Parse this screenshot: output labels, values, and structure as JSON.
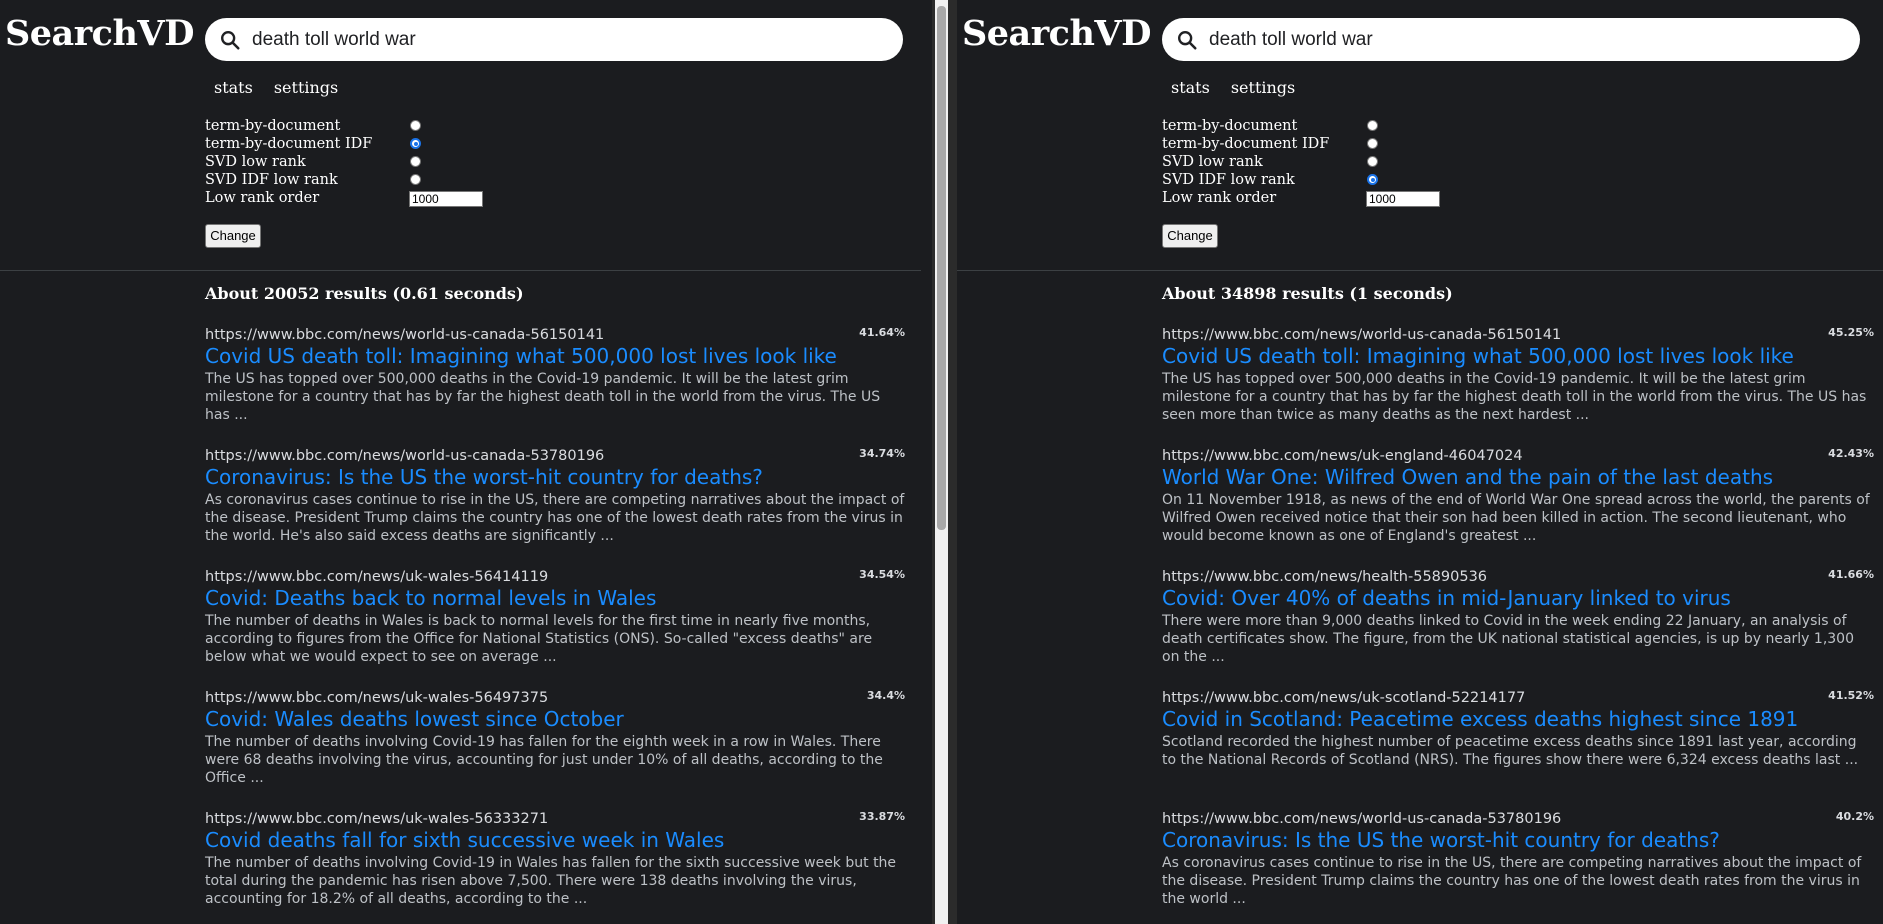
{
  "panes": [
    {
      "logo": "SearchVD",
      "query": "death toll world war",
      "nav": [
        "stats",
        "settings"
      ],
      "options": [
        {
          "label": "term-by-document",
          "checked": false
        },
        {
          "label": "term-by-document IDF",
          "checked": true
        },
        {
          "label": "SVD low rank",
          "checked": false
        },
        {
          "label": "SVD IDF low rank",
          "checked": false
        }
      ],
      "low_rank_label": "Low rank order",
      "low_rank_value": "1000",
      "change_label": "Change",
      "results_count": "About 20052 results (0.61 seconds)",
      "results": [
        {
          "url": "https://www.bbc.com/news/world-us-canada-56150141",
          "score": "41.64%",
          "title": "Covid US death toll: Imagining what 500,000 lost lives look like",
          "snippet": "The US has topped over 500,000 deaths in the Covid-19 pandemic. It will be the latest grim milestone for a country that has by far the highest death toll in the world from the virus. The US has ..."
        },
        {
          "url": "https://www.bbc.com/news/world-us-canada-53780196",
          "score": "34.74%",
          "title": "Coronavirus: Is the US the worst-hit country for deaths?",
          "snippet": "As coronavirus cases continue to rise in the US, there are competing narratives about the impact of the disease. President Trump claims the country has one of the lowest death rates from the virus in the world. He's also said excess deaths are significantly ..."
        },
        {
          "url": "https://www.bbc.com/news/uk-wales-56414119",
          "score": "34.54%",
          "title": "Covid: Deaths back to normal levels in Wales",
          "snippet": "The number of deaths in Wales is back to normal levels for the first time in nearly five months, according to figures from the Office for National Statistics (ONS). So-called \"excess deaths\" are below what we would expect to see on average ..."
        },
        {
          "url": "https://www.bbc.com/news/uk-wales-56497375",
          "score": "34.4%",
          "title": "Covid: Wales deaths lowest since October",
          "snippet": "The number of deaths involving Covid-19 has fallen for the eighth week in a row in Wales. There were 68 deaths involving the virus, accounting for just under 10% of all deaths, according to the Office ..."
        },
        {
          "url": "https://www.bbc.com/news/uk-wales-56333271",
          "score": "33.87%",
          "title": "Covid deaths fall for sixth successive week in Wales",
          "snippet": "The number of deaths involving Covid-19 in Wales has fallen for the sixth successive week but the total during the pandemic has risen above 7,500. There were 138 deaths involving the virus, accounting for 18.2% of all deaths, according to the ..."
        }
      ]
    },
    {
      "logo": "SearchVD",
      "query": "death toll world war",
      "nav": [
        "stats",
        "settings"
      ],
      "options": [
        {
          "label": "term-by-document",
          "checked": false
        },
        {
          "label": "term-by-document IDF",
          "checked": false
        },
        {
          "label": "SVD low rank",
          "checked": false
        },
        {
          "label": "SVD IDF low rank",
          "checked": true
        }
      ],
      "low_rank_label": "Low rank order",
      "low_rank_value": "1000",
      "change_label": "Change",
      "results_count": "About 34898 results (1 seconds)",
      "results": [
        {
          "url": "https://www.bbc.com/news/world-us-canada-56150141",
          "score": "45.25%",
          "title": "Covid US death toll: Imagining what 500,000 lost lives look like",
          "snippet": "The US has topped over 500,000 deaths in the Covid-19 pandemic. It will be the latest grim milestone for a country that has by far the highest death toll in the world from the virus. The US has seen more than twice as many deaths as the next hardest ..."
        },
        {
          "url": "https://www.bbc.com/news/uk-england-46047024",
          "score": "42.43%",
          "title": "World War One: Wilfred Owen and the pain of the last deaths",
          "snippet": "On 11 November 1918, as news of the end of World War One spread across the world, the parents of Wilfred Owen received notice that their son had been killed in action. The second lieutenant, who would become known as one of England's greatest ..."
        },
        {
          "url": "https://www.bbc.com/news/health-55890536",
          "score": "41.66%",
          "title": "Covid: Over 40% of deaths in mid-January linked to virus",
          "snippet": "There were more than 9,000 deaths linked to Covid in the week ending 22 January, an analysis of death certificates show. The figure, from the UK national statistical agencies, is up by nearly 1,300 on the ..."
        },
        {
          "url": "https://www.bbc.com/news/uk-scotland-52214177",
          "score": "41.52%",
          "title": "Covid in Scotland: Peacetime excess deaths highest since 1891",
          "snippet": "Scotland recorded the highest number of peacetime excess deaths since 1891 last year, according to the National Records of Scotland (NRS). The figures show there were 6,324 excess deaths last ..."
        },
        {
          "url": "https://www.bbc.com/news/world-us-canada-53780196",
          "score": "40.2%",
          "title": "Coronavirus: Is the US the worst-hit country for deaths?",
          "snippet": "As coronavirus cases continue to rise in the US, there are competing narratives about the impact of the disease. President Trump claims the country has one of the lowest death rates from the virus in the world ..."
        }
      ]
    }
  ]
}
